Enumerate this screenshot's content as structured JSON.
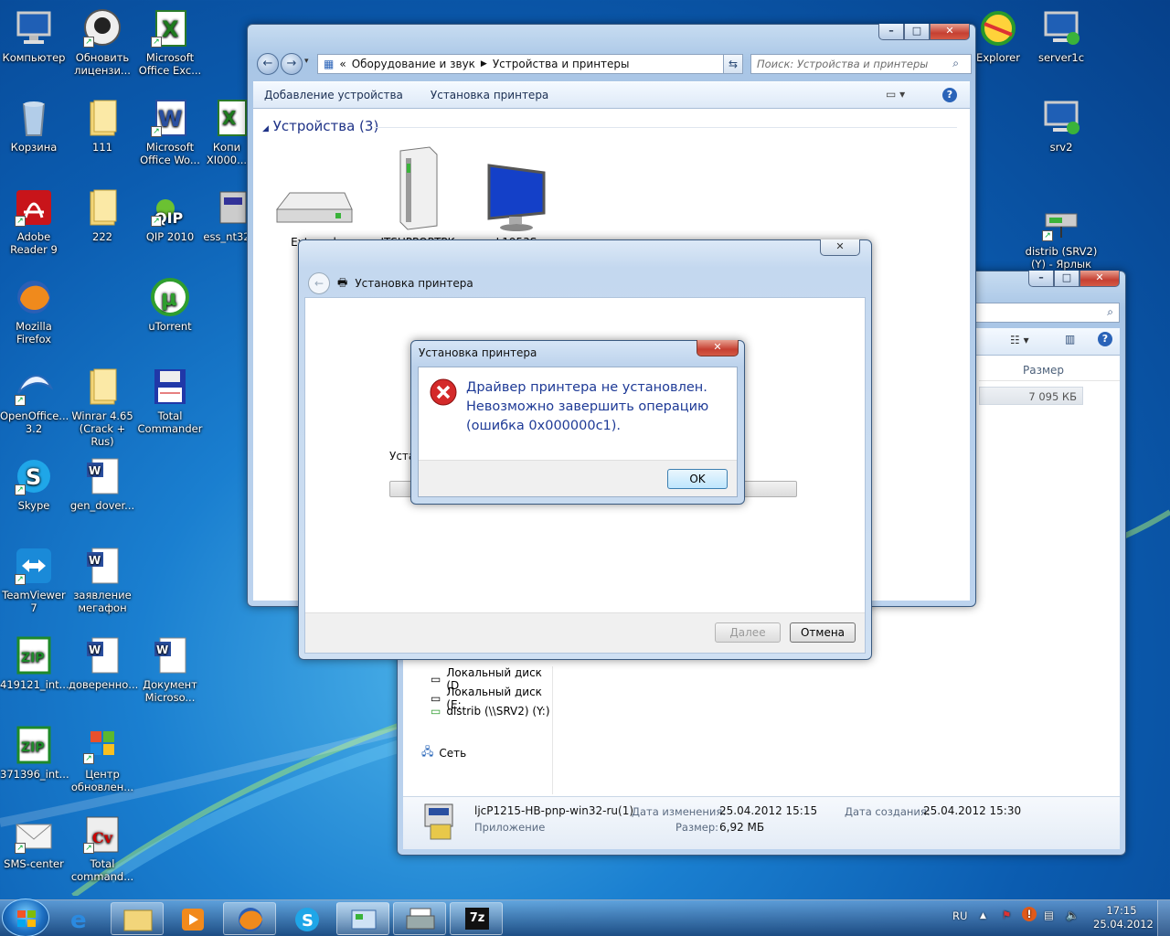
{
  "desktop": {
    "icons": [
      {
        "label": "Компьютер"
      },
      {
        "label": "Обновить лицензи..."
      },
      {
        "label": "Microsoft Office Exc..."
      },
      {
        "label": "Корзина"
      },
      {
        "label": "111"
      },
      {
        "label": "Microsoft Office Wo..."
      },
      {
        "label": "Копи XI000..."
      },
      {
        "label": "Adobe Reader 9"
      },
      {
        "label": "222"
      },
      {
        "label": "QIP 2010"
      },
      {
        "label": "ess_nt32"
      },
      {
        "label": "Mozilla Firefox"
      },
      {
        "label": "uTorrent"
      },
      {
        "label": "OpenOffice... 3.2"
      },
      {
        "label": "Winrar 4.65 (Crack + Rus)"
      },
      {
        "label": "Total Commander"
      },
      {
        "label": "Skype"
      },
      {
        "label": "gen_dover..."
      },
      {
        "label": "TeamViewer 7"
      },
      {
        "label": "заявление мегафон"
      },
      {
        "label": "419121_int..."
      },
      {
        "label": "доверенно..."
      },
      {
        "label": "Документ Microso..."
      },
      {
        "label": "371396_int..."
      },
      {
        "label": "Центр обновлен..."
      },
      {
        "label": "SMS-center"
      },
      {
        "label": "Total command..."
      },
      {
        "label": "Explorer"
      },
      {
        "label": "server1c"
      },
      {
        "label": "srv2"
      },
      {
        "label": "distrib (SRV2) (Y) - Ярлык"
      }
    ]
  },
  "devices_window": {
    "breadcrumb_root": "«",
    "breadcrumb": [
      "Оборудование и звук",
      "Устройства и принтеры"
    ],
    "search_placeholder": "Поиск: Устройства и принтеры",
    "commands": [
      "Добавление устройства",
      "Установка принтера"
    ],
    "group_title": "Устройства (3)",
    "devices": [
      {
        "label": "External"
      },
      {
        "label": "ITSUPPORTPK"
      },
      {
        "label": "L1953S"
      }
    ]
  },
  "file_window": {
    "column_size": "Размер",
    "size_value": "7 095 КБ",
    "tree": [
      {
        "label": "Локальный диск (D"
      },
      {
        "label": "Локальный диск (E:"
      },
      {
        "label": "distrib (\\\\SRV2) (Y:)"
      }
    ],
    "network": "Сеть",
    "details": {
      "name": "ljcP1215-HB-pnp-win32-ru(1)",
      "modified_label": "Дата изменения:",
      "modified_value": "25.04.2012 15:15",
      "created_label": "Дата создания:",
      "created_value": "25.04.2012 15:30",
      "type": "Приложение",
      "size_label": "Размер:",
      "size_value": "6,92 МБ"
    }
  },
  "wizard": {
    "title": "Установка принтера",
    "status_text": "Уста",
    "next_label": "Далее",
    "cancel_label": "Отмена"
  },
  "error_dialog": {
    "title": "Установка принтера",
    "message_line1": "Драйвер принтера не установлен.",
    "message_line2": "Невозможно завершить операцию",
    "message_line3": "(ошибка 0x000000c1).",
    "ok_label": "OK"
  },
  "taskbar": {
    "lang": "RU",
    "time": "17:15",
    "date": "25.04.2012"
  },
  "colors": {
    "error_text": "#1e3a96",
    "close_button": "#c64032"
  }
}
